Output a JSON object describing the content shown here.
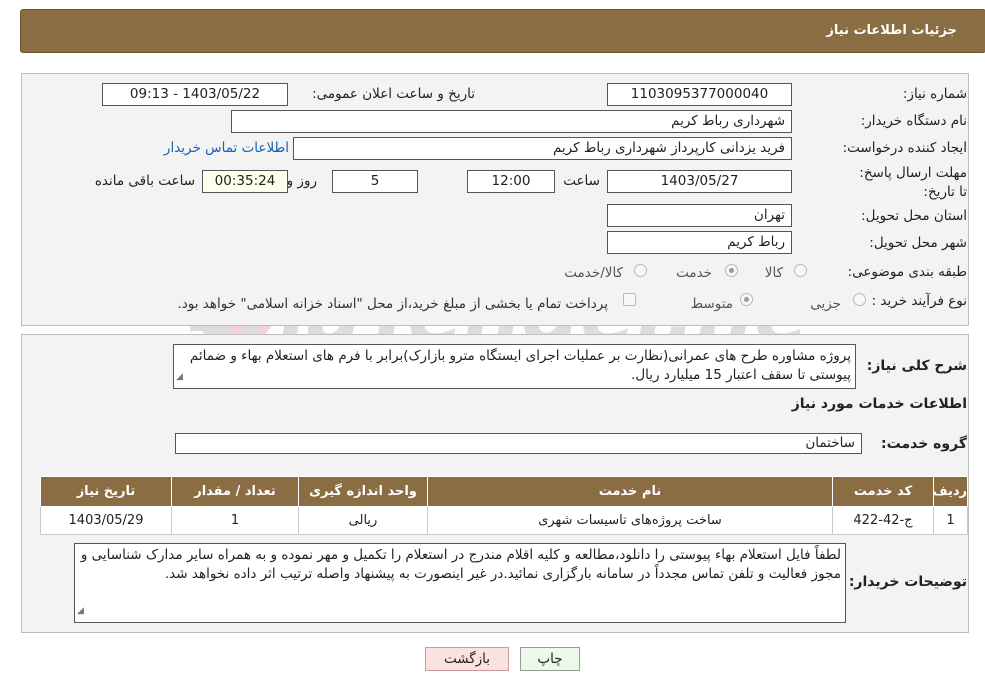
{
  "header": {
    "title": "جزئیات اطلاعات نیاز"
  },
  "need_info": {
    "need_number_label": "شماره نیاز:",
    "need_number": "1103095377000040",
    "announce_label": "تاریخ و ساعت اعلان عمومی:",
    "announce_value": "1403/05/22 - 09:13",
    "buyer_org_label": "نام دستگاه خریدار:",
    "buyer_org": "شهرداری رباط کریم",
    "creator_label": "ایجاد کننده درخواست:",
    "creator": "فرید یزدانی کارپرداز شهرداری رباط کریم",
    "contact_link": "اطلاعات تماس خریدار",
    "deadline_label": "مهلت ارسال پاسخ: تا تاریخ:",
    "deadline_date": "1403/05/27",
    "time_label": "ساعت",
    "deadline_time": "12:00",
    "days_value": "5",
    "days_label": "روز و",
    "remaining_value": "00:35:24",
    "remaining_label": "ساعت باقی مانده",
    "province_label": "استان محل تحویل:",
    "province": "تهران",
    "city_label": "شهر محل تحویل:",
    "city": "رباط کریم",
    "category_label": "طبقه بندی موضوعی:",
    "category_options": [
      "کالا",
      "خدمت",
      "کالا/خدمت"
    ],
    "category_selected": "خدمت",
    "purchase_type_label": "نوع فرآیند خرید :",
    "purchase_options": [
      "جزیی",
      "متوسط"
    ],
    "purchase_selected": "متوسط",
    "payment_note": "پرداخت تمام یا بخشی از مبلغ خرید،از محل \"اسناد خزانه اسلامی\" خواهد بود."
  },
  "details": {
    "description_label": "شرح کلی نیاز:",
    "description": "پروژه مشاوره طرح های عمرانی(نظارت بر عملیات اجرای ایستگاه مترو بازارک)برابر با فرم های استعلام بهاء و ضمائم پیوستی تا سقف اعتبار 15 میلیارد ریال.",
    "services_heading": "اطلاعات خدمات مورد نیاز",
    "service_group_label": "گروه خدمت:",
    "service_group": "ساختمان",
    "table_headers": [
      "ردیف",
      "کد خدمت",
      "نام خدمت",
      "واحد اندازه گیری",
      "تعداد / مقدار",
      "تاریخ نیاز"
    ],
    "table_rows": [
      [
        "1",
        "ج-42-422",
        "ساخت پروژه‌های تاسیسات شهری",
        "ریالی",
        "1",
        "1403/05/29"
      ]
    ],
    "buyer_notes_label": "توضیحات خریدار:",
    "buyer_notes": "لطفاً فایل استعلام بهاء پیوستی را دانلود،مطالعه و کلیه اقلام مندرج در استعلام را تکمیل و مهر نموده و به همراه سایر مدارک شناسایی و مجوز فعالیت و تلفن تماس مجدداً در سامانه بارگزاری نمائید.در غیر اینصورت به پیشنهاد واصله ترتیب اثر داده نخواهد شد."
  },
  "buttons": {
    "print": "چاپ",
    "back": "بازگشت"
  },
  "colors": {
    "header_bg": "#8b6d43",
    "print_btn": "#eaf9e8",
    "back_btn": "#fbe1e1",
    "link": "#1a5fb4"
  }
}
